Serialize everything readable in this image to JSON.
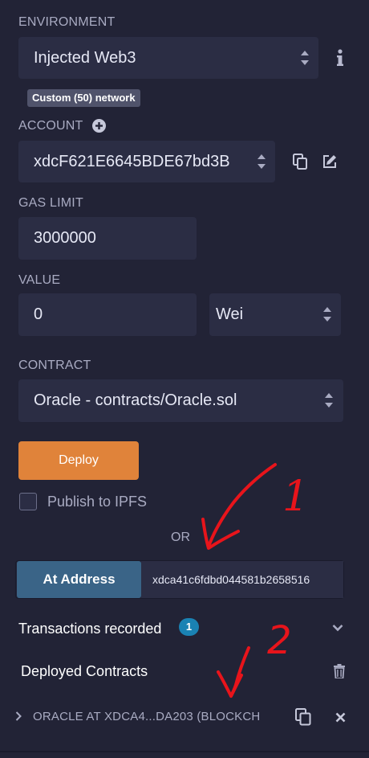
{
  "environment": {
    "label": "ENVIRONMENT",
    "value": "Injected Web3",
    "network_badge": "Custom (50) network"
  },
  "account": {
    "label": "ACCOUNT",
    "value": "xdcF621E6645BDE67bd3B"
  },
  "gas_limit": {
    "label": "GAS LIMIT",
    "value": "3000000"
  },
  "value_field": {
    "label": "VALUE",
    "amount": "0",
    "unit": "Wei"
  },
  "contract": {
    "label": "CONTRACT",
    "value": "Oracle - contracts/Oracle.sol"
  },
  "deploy": {
    "label": "Deploy",
    "publish_label": "Publish to IPFS",
    "publish_checked": false,
    "or_label": "OR"
  },
  "at_address": {
    "button_label": "At Address",
    "address_value": "xdca41c6fdbd044581b2658516"
  },
  "transactions": {
    "label": "Transactions recorded",
    "count": "1"
  },
  "deployed": {
    "label": "Deployed Contracts",
    "instance_label": "ORACLE AT XDCA4...DA203 (BLOCKCH"
  },
  "annotations": {
    "number_1": "1",
    "number_2": "2",
    "color": "#e8141b"
  },
  "colors": {
    "background": "#222336",
    "field": "#2b2d44",
    "deploy_button": "#e0833a",
    "at_address_button": "#3a6487",
    "badge": "#1a82b3"
  }
}
